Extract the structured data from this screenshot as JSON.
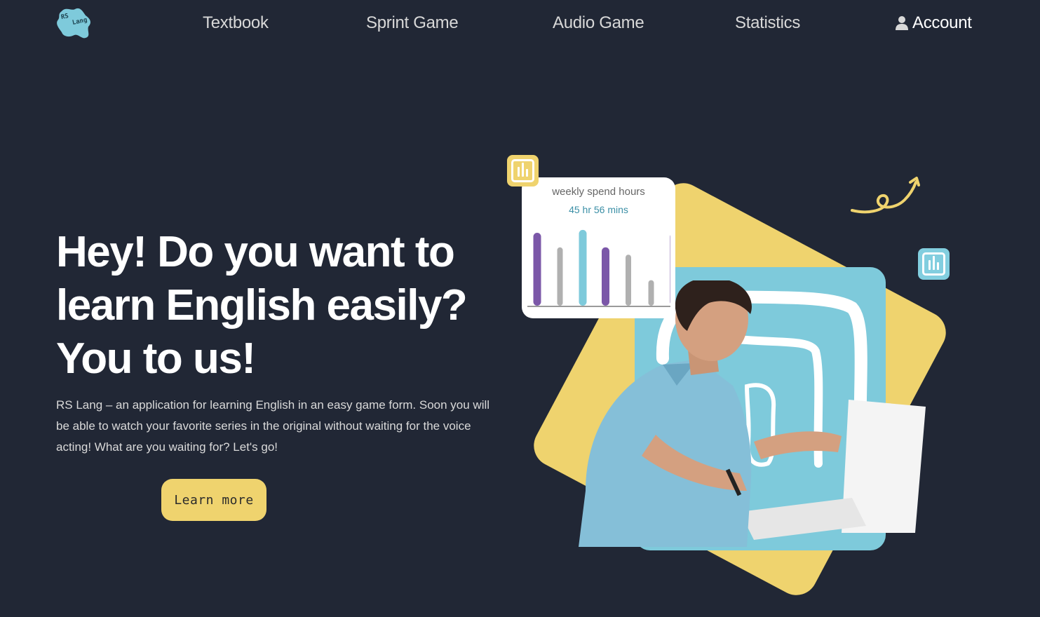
{
  "brand": {
    "logo_line1": "RS",
    "logo_line2": "Lang",
    "logo_color": "#7ecadb"
  },
  "nav": {
    "items": [
      {
        "label": "Textbook"
      },
      {
        "label": "Sprint Game"
      },
      {
        "label": "Audio Game"
      },
      {
        "label": "Statistics"
      }
    ],
    "account_label": "Account",
    "account_icon": "user-icon"
  },
  "hero": {
    "title": "Hey! Do you want to learn English easily? You to us!",
    "description": "RS Lang – an application for learning English in an easy game form. Soon you will be able to watch your favorite series in the original without waiting for the voice acting! What are you waiting for? Let's go!",
    "button_label": "Learn more"
  },
  "stat_card": {
    "title": "weekly spend hours",
    "value": "45 hr 56 mins",
    "bars": [
      {
        "value": 1.0,
        "color": "#7b57a8"
      },
      {
        "value": 0.8,
        "color": "#b0b0b0"
      },
      {
        "value": 1.04,
        "color": "#7ecadb"
      },
      {
        "value": 0.8,
        "color": "#7b57a8"
      },
      {
        "value": 0.7,
        "color": "#b0b0b0"
      },
      {
        "value": 0.35,
        "color": "#b0b0b0"
      },
      {
        "value": 1.0,
        "color": "#7b57a8"
      }
    ]
  },
  "colors": {
    "background": "#212735",
    "accent_yellow": "#efd36e",
    "accent_blue": "#7ecadb",
    "accent_purple": "#7b57a8"
  },
  "icons": {
    "badge_top": "bar-chart-icon",
    "badge_right": "bar-chart-icon",
    "squiggle": "curly-arrow-icon"
  }
}
